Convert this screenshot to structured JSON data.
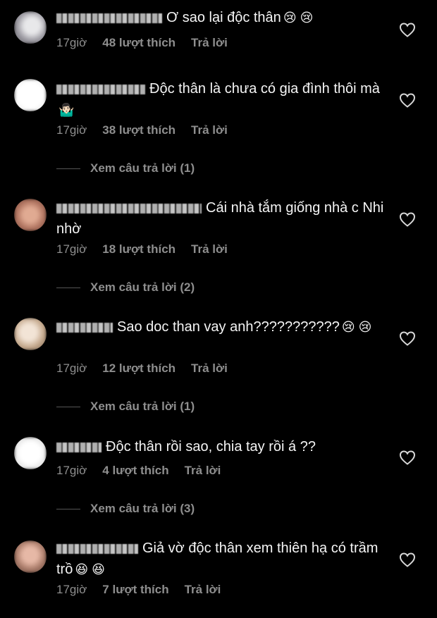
{
  "comments": [
    {
      "text": "Ơ sao lại độc thân",
      "emoji": "😢 😢",
      "time": "17giờ",
      "likes": "48 lượt thích",
      "reply": "Trả lời",
      "avatar_colors": [
        "#d8d8dc",
        "#7c7a80"
      ]
    },
    {
      "text": "Độc thân là chưa có gia đình thôi mà",
      "emoji": "🤷🏻‍♂️",
      "time": "17giờ",
      "likes": "38 lượt thích",
      "reply": "Trả lời",
      "view_replies": "Xem câu trả lời (1)",
      "avatar_colors": [
        "#ffffff",
        "#e6e6e6"
      ]
    },
    {
      "text": "Cái nhà tắm giống nhà c Nhi nhờ",
      "emoji": "",
      "time": "17giờ",
      "likes": "18 lượt thích",
      "reply": "Trả lời",
      "view_replies": "Xem câu trả lời (2)",
      "avatar_colors": [
        "#d39a86",
        "#8a5a4a"
      ]
    },
    {
      "text": "Sao doc than vay anh???????????",
      "emoji": "😢 😢",
      "time": "17giờ",
      "likes": "12 lượt thích",
      "reply": "Trả lời",
      "view_replies": "Xem câu trả lời (1)",
      "avatar_colors": [
        "#e9d8c8",
        "#a89078"
      ]
    },
    {
      "text": "Độc thân rồi sao, chia tay rồi á ??",
      "emoji": "",
      "time": "17giờ",
      "likes": "4 lượt thích",
      "reply": "Trả lời",
      "view_replies": "Xem câu trả lời (3)",
      "avatar_colors": [
        "#f2f2f2",
        "#dadada"
      ]
    },
    {
      "text": "Giả vờ độc thân xem thiên hạ có trầm trồ",
      "emoji": "😆 😆",
      "time": "17giờ",
      "likes": "7 lượt thích",
      "reply": "Trả lời",
      "avatar_colors": [
        "#d6a89a",
        "#7d5a50"
      ]
    }
  ]
}
